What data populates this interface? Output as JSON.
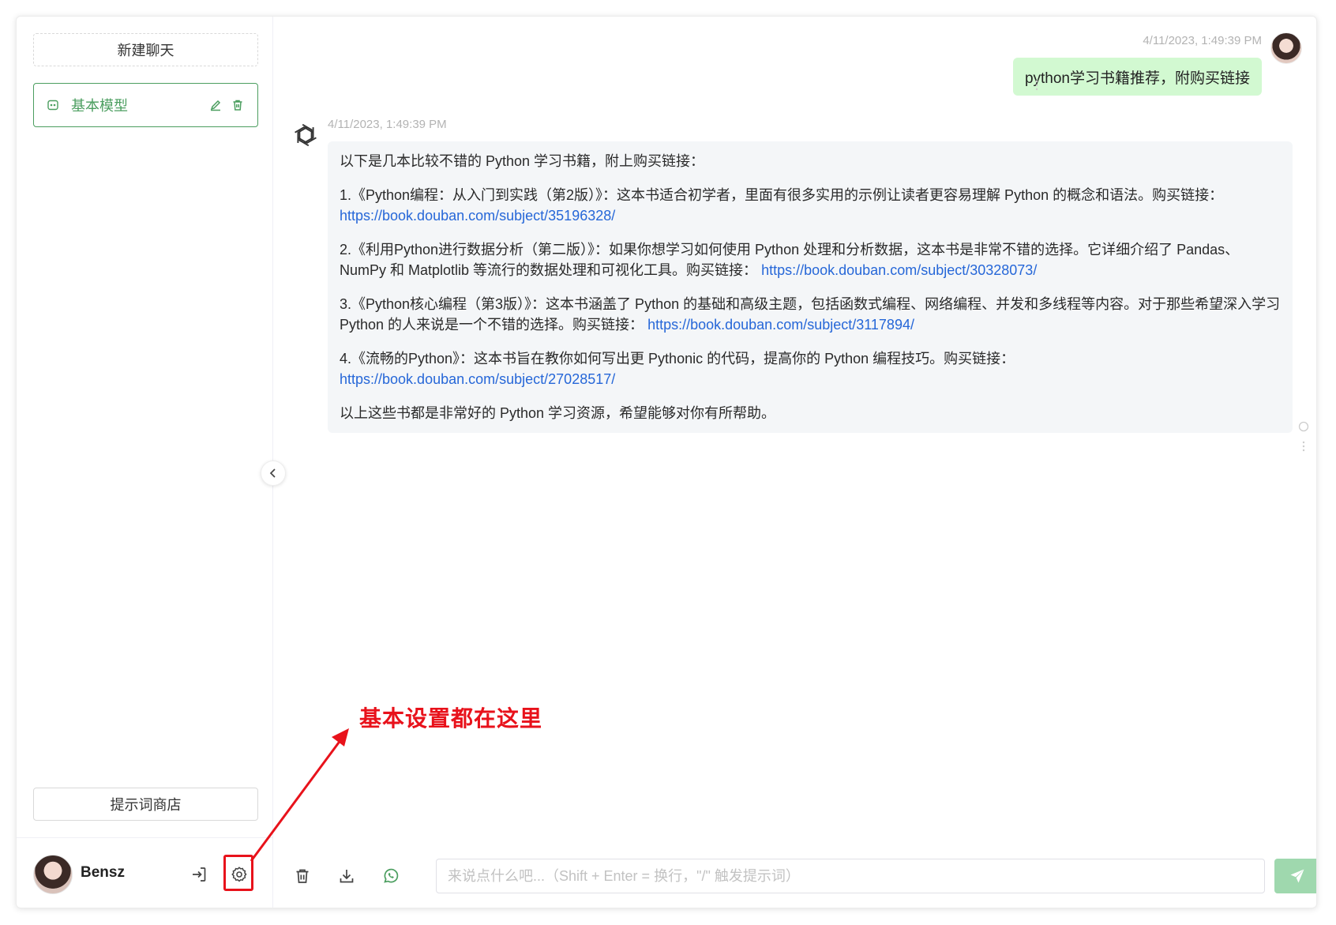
{
  "sidebar": {
    "new_chat_label": "新建聊天",
    "chats": [
      {
        "title": "基本模型",
        "active": true
      }
    ],
    "prompt_store_label": "提示词商店",
    "user": {
      "name": "Bensz"
    }
  },
  "messages": [
    {
      "role": "user",
      "timestamp": "4/11/2023, 1:49:39 PM",
      "text": "python学习书籍推荐，附购买链接"
    },
    {
      "role": "assistant",
      "timestamp": "4/11/2023, 1:49:39 PM",
      "intro": "以下是几本比较不错的 Python 学习书籍，附上购买链接：",
      "items": [
        {
          "text": "1.《Python编程：从入门到实践（第2版）》：这本书适合初学者，里面有很多实用的示例让读者更容易理解 Python 的概念和语法。购买链接：",
          "link": "https://book.douban.com/subject/35196328/"
        },
        {
          "text": "2.《利用Python进行数据分析（第二版）》：如果你想学习如何使用 Python 处理和分析数据，这本书是非常不错的选择。它详细介绍了 Pandas、NumPy 和 Matplotlib 等流行的数据处理和可视化工具。购买链接：",
          "link": "https://book.douban.com/subject/30328073/"
        },
        {
          "text": "3.《Python核心编程（第3版）》：这本书涵盖了 Python 的基础和高级主题，包括函数式编程、网络编程、并发和多线程等内容。对于那些希望深入学习 Python 的人来说是一个不错的选择。购买链接：",
          "link": "https://book.douban.com/subject/3117894/"
        },
        {
          "text": "4.《流畅的Python》：这本书旨在教你如何写出更 Pythonic 的代码，提高你的 Python 编程技巧。购买链接：",
          "link": "https://book.douban.com/subject/27028517/"
        }
      ],
      "outro": "以上这些书都是非常好的 Python 学习资源，希望能够对你有所帮助。"
    }
  ],
  "input": {
    "placeholder": "来说点什么吧...（Shift + Enter = 换行，\"/\" 触发提示词）",
    "value": ""
  },
  "annotation": {
    "text": "基本设置都在这里"
  },
  "colors": {
    "accent": "#4b9e5f",
    "user_bubble": "#d2f9d1",
    "bot_bubble": "#f4f6f8",
    "link": "#2667d8",
    "send_button": "#9fd8ae",
    "annotation": "#e8121b"
  },
  "icons": {
    "chat_item": "chat-bubble-icon",
    "edit": "edit-icon",
    "delete": "trash-icon",
    "logout": "logout-icon",
    "settings": "gear-icon",
    "collapse": "chevron-left-icon",
    "clear": "trash-icon",
    "download": "download-icon",
    "context": "whatsapp-icon",
    "send": "send-icon",
    "bot": "openai-logo-icon"
  }
}
